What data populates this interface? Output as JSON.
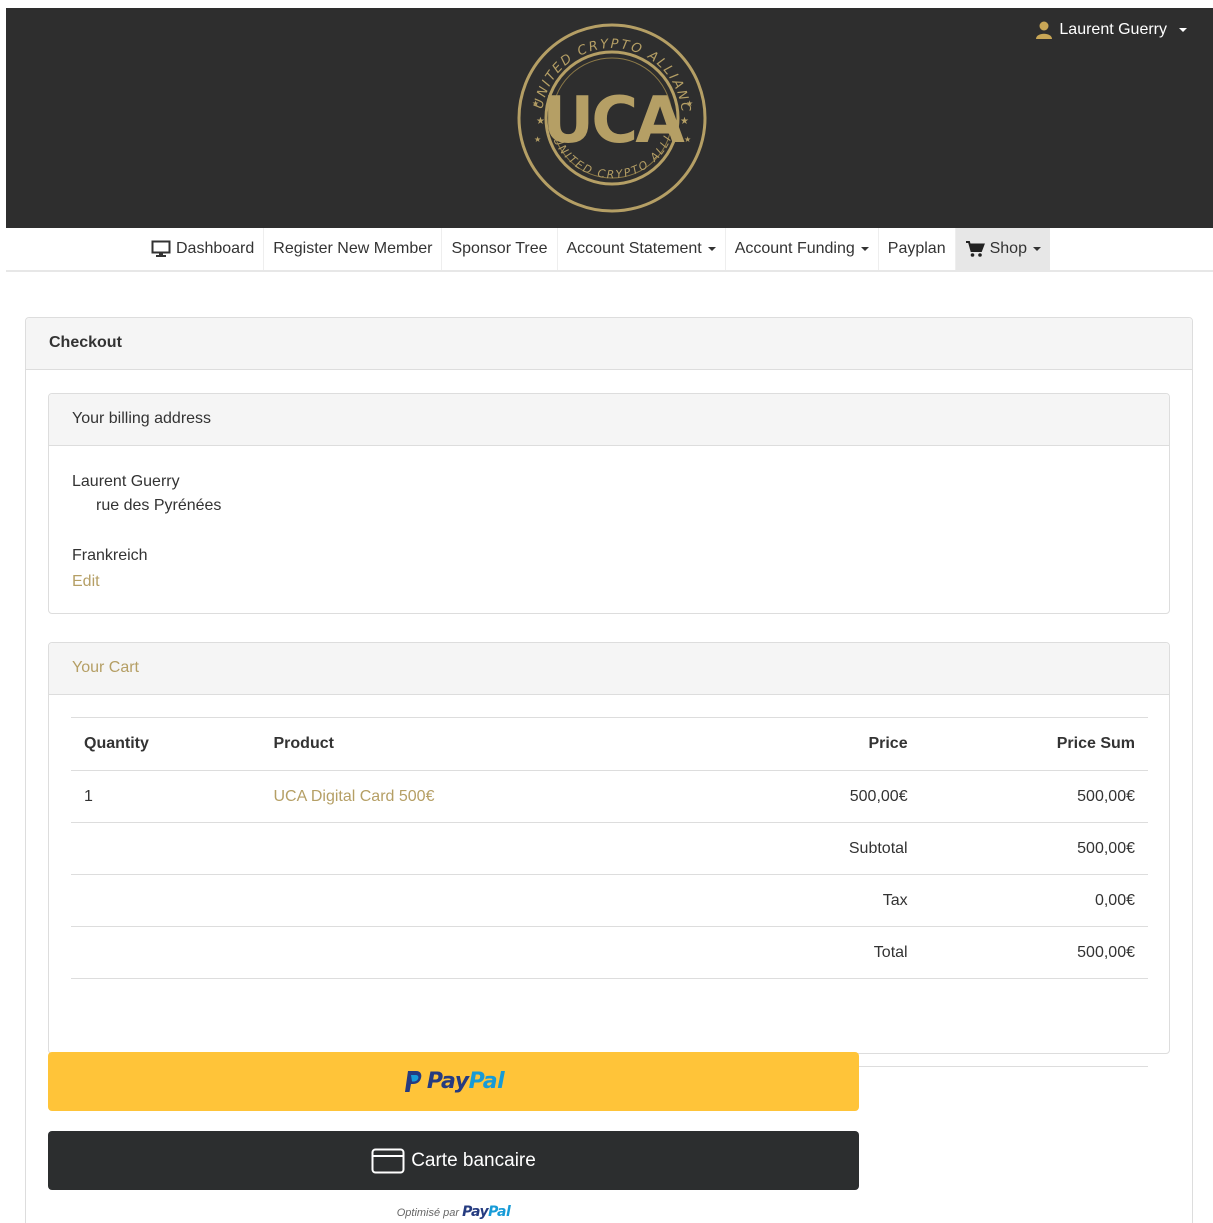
{
  "header": {
    "logo_name": "uca-logo",
    "user_name": "Laurent Guerry",
    "colors": {
      "background": "#2e2e2e",
      "gold": "#b59f65"
    }
  },
  "nav": {
    "items": [
      {
        "label": "Dashboard",
        "icon": "monitor-icon"
      },
      {
        "label": "Register New Member"
      },
      {
        "label": "Sponsor Tree"
      },
      {
        "label": "Account Statement",
        "dropdown": true
      },
      {
        "label": "Account Funding",
        "dropdown": true
      },
      {
        "label": "Payplan"
      },
      {
        "label": "Shop",
        "icon": "cart-icon",
        "dropdown": true,
        "active": true
      }
    ]
  },
  "checkout": {
    "title": "Checkout",
    "billing": {
      "title": "Your billing address",
      "name": "Laurent Guerry",
      "street": "rue des Pyrénées",
      "country": "Frankreich",
      "edit_label": "Edit"
    },
    "cart": {
      "title": "Your Cart",
      "columns": [
        "Quantity",
        "Product",
        "Price",
        "Price Sum"
      ],
      "rows": [
        {
          "quantity": "1",
          "product": "UCA Digital Card 500€",
          "price": "500,00€",
          "sum": "500,00€"
        }
      ],
      "subtotal_label": "Subtotal",
      "subtotal": "500,00€",
      "tax_label": "Tax",
      "tax": "0,00€",
      "total_label": "Total",
      "total": "500,00€"
    }
  },
  "payment": {
    "paypal_pay": "Pay",
    "paypal_pal": "Pal",
    "card_label": "Carte bancaire",
    "powered_prefix": "Optimisé par",
    "colors": {
      "paypal_button": "#ffc439",
      "card_button": "#2c2e2f"
    }
  }
}
